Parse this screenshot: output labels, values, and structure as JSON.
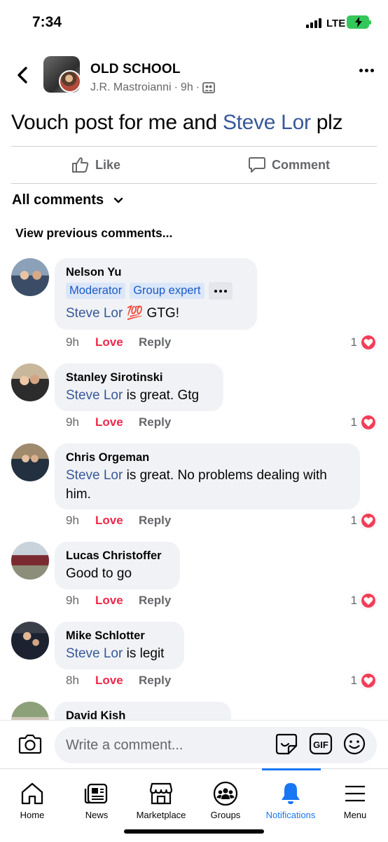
{
  "status_bar": {
    "time": "7:34",
    "network": "LTE"
  },
  "post": {
    "group_name": "OLD SCHOOL",
    "author": "J.R. Mastroianni",
    "time": "9h",
    "text_before": "Vouch post for me and ",
    "text_mention": "Steve Lor",
    "text_after": " plz"
  },
  "actions": {
    "like_label": "Like",
    "comment_label": "Comment"
  },
  "all_comments_label": "All comments",
  "view_previous_label": "View previous comments...",
  "comments": [
    {
      "author": "Nelson Yu",
      "badges": [
        "Moderator",
        "Group expert"
      ],
      "mention": "Steve Lor",
      "text": "💯 GTG!",
      "time": "9h",
      "love_label": "Love",
      "reply_label": "Reply",
      "reactions": "1"
    },
    {
      "author": "Stanley Sirotinski",
      "mention": "Steve Lor",
      "text": "is great.  Gtg",
      "time": "9h",
      "love_label": "Love",
      "reply_label": "Reply",
      "reactions": "1"
    },
    {
      "author": "Chris Orgeman",
      "mention": "Steve Lor",
      "text": "is great. No problems dealing with",
      "text_line2": "him.",
      "time": "9h",
      "love_label": "Love",
      "reply_label": "Reply",
      "reactions": "1"
    },
    {
      "author": "Lucas Christoffer",
      "text": "Good to go",
      "time": "9h",
      "love_label": "Love",
      "reply_label": "Reply",
      "reactions": "1"
    },
    {
      "author": "Mike Schlotter",
      "mention": "Steve Lor",
      "text": "is legit",
      "time": "8h",
      "love_label": "Love",
      "reply_label": "Reply",
      "reactions": "1"
    },
    {
      "author": "David Kish"
    }
  ],
  "composer": {
    "placeholder": "Write a comment..."
  },
  "tabs": [
    {
      "label": "Home",
      "icon": "home-icon"
    },
    {
      "label": "News",
      "icon": "news-icon"
    },
    {
      "label": "Marketplace",
      "icon": "marketplace-icon"
    },
    {
      "label": "Groups",
      "icon": "groups-icon"
    },
    {
      "label": "Notifications",
      "icon": "bell-icon",
      "active": true
    },
    {
      "label": "Menu",
      "icon": "menu-icon"
    }
  ],
  "colors": {
    "link": "#385898",
    "love": "#f0284a",
    "active_tab": "#1877f2",
    "bubble": "#f0f2f5",
    "badge_bg": "#dbe7f9",
    "badge_text": "#1a5bc7"
  }
}
